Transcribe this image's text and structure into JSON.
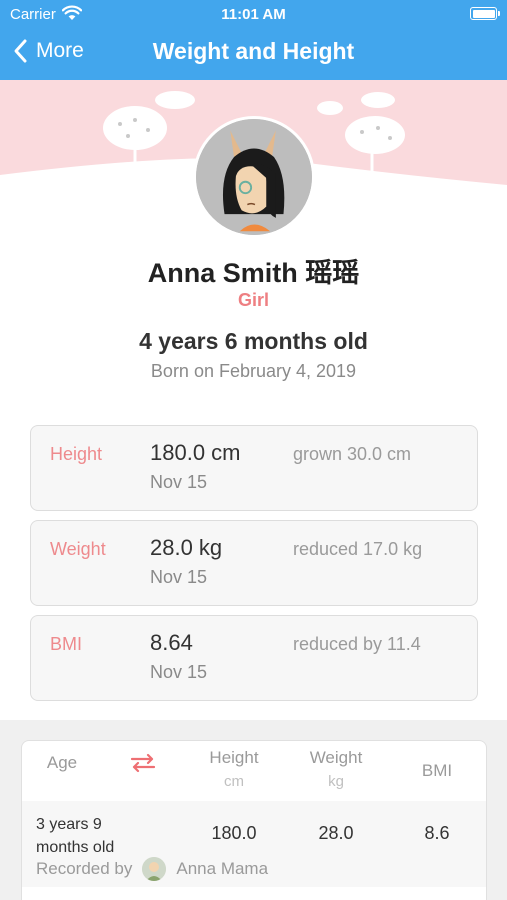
{
  "status_bar": {
    "carrier": "Carrier",
    "time": "11:01 AM"
  },
  "nav": {
    "back_label": "More",
    "title": "Weight and Height"
  },
  "profile": {
    "name": "Anna Smith 瑶瑶",
    "gender": "Girl",
    "age": "4 years 6 months old",
    "born": "Born on February 4, 2019"
  },
  "cards": [
    {
      "label": "Height",
      "value": "180.0 cm",
      "date": "Nov 15",
      "change": "grown 30.0 cm"
    },
    {
      "label": "Weight",
      "value": "28.0 kg",
      "date": "Nov 15",
      "change": "reduced 17.0 kg"
    },
    {
      "label": "BMI",
      "value": "8.64",
      "date": "Nov 15",
      "change": "reduced by 11.4"
    }
  ],
  "table": {
    "headers": {
      "age": "Age",
      "height": "Height",
      "height_unit": "cm",
      "weight": "Weight",
      "weight_unit": "kg",
      "bmi": "BMI"
    },
    "rows": [
      {
        "age": "3 years 9 months old",
        "height": "180.0",
        "weight": "28.0",
        "bmi": "8.6",
        "recorded_by_label": "Recorded by",
        "recorder": "Anna Mama"
      }
    ]
  },
  "colors": {
    "nav_blue": "#42a6ed",
    "accent_pink": "#ee8a8d",
    "hero_pink": "#fadadd"
  },
  "icons": [
    "wifi-icon",
    "battery-icon",
    "back-chevron-icon",
    "swap-arrows-icon",
    "tree-icon",
    "cloud-icon"
  ]
}
